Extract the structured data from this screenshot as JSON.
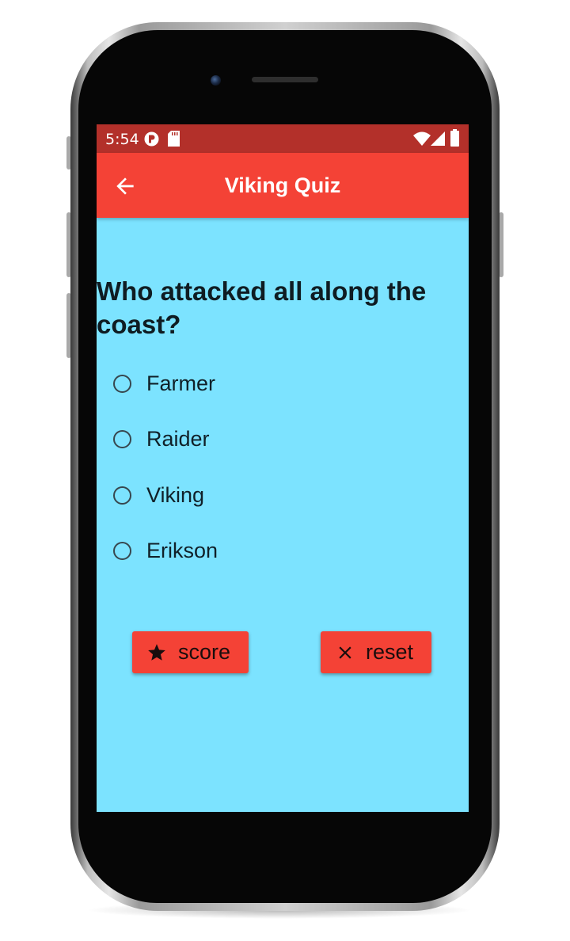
{
  "status_bar": {
    "time": "5:54"
  },
  "app_bar": {
    "title": "Viking Quiz",
    "back_icon": "arrow-left-icon"
  },
  "quiz": {
    "question": "Who attacked all along the coast?",
    "options": [
      {
        "label": "Farmer",
        "selected": false
      },
      {
        "label": "Raider",
        "selected": false
      },
      {
        "label": "Viking",
        "selected": false
      },
      {
        "label": "Erikson",
        "selected": false
      }
    ]
  },
  "actions": {
    "score_label": "score",
    "score_icon": "star-icon",
    "reset_label": "reset",
    "reset_icon": "close-icon"
  },
  "colors": {
    "status_bar": "#b3302a",
    "app_bar": "#f44236",
    "background": "#7ce3ff",
    "button": "#f44236"
  }
}
